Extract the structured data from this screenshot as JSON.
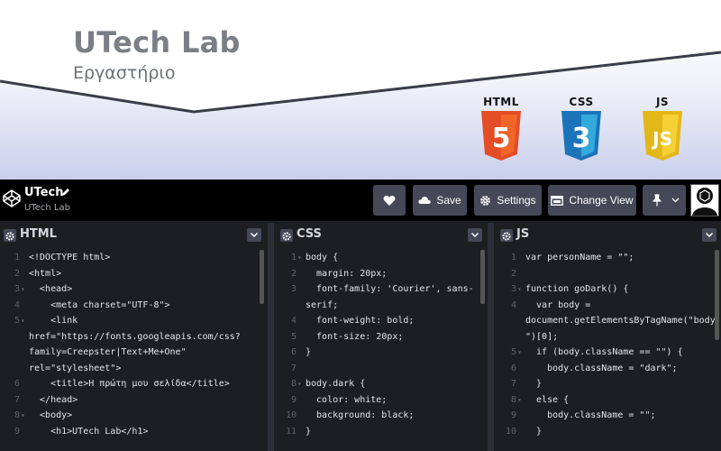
{
  "banner": {
    "title": "UTech Lab",
    "subtitle": "Εργαστήριο",
    "badges": [
      {
        "label": "HTML",
        "glyph": "5",
        "color": "#e44d26",
        "icon": "html5-icon"
      },
      {
        "label": "CSS",
        "glyph": "3",
        "color": "#1f77c7",
        "icon": "css3-icon"
      },
      {
        "label": "JS",
        "glyph": "JS",
        "color": "#f0c419",
        "icon": "js-icon"
      }
    ]
  },
  "topbar": {
    "project_title": "UTech",
    "project_author": "UTech Lab",
    "save_label": "Save",
    "settings_label": "Settings",
    "change_view_label": "Change View"
  },
  "panes": {
    "html": {
      "name": "HTML",
      "lines": [
        {
          "n": "1",
          "t": "<!DOCTYPE html>"
        },
        {
          "n": "2",
          "t": "<html>"
        },
        {
          "n": "3",
          "t": "  <head>",
          "fold": true
        },
        {
          "n": "4",
          "t": "    <meta charset=\"UTF-8\">"
        },
        {
          "n": "5",
          "t": "    <link",
          "fold": true
        },
        {
          "n": "",
          "t": "href=\"https://fonts.googleapis.com/css?"
        },
        {
          "n": "",
          "t": "family=Creepster|Text+Me+One\""
        },
        {
          "n": "",
          "t": "rel=\"stylesheet\">"
        },
        {
          "n": "6",
          "t": "    <title>Η πρώτη μου σελίδα</title>"
        },
        {
          "n": "7",
          "t": "  </head>"
        },
        {
          "n": "8",
          "t": "  <body>",
          "fold": true
        },
        {
          "n": "9",
          "t": "    <h1>UTech Lab</h1>"
        }
      ]
    },
    "css": {
      "name": "CSS",
      "lines": [
        {
          "n": "1",
          "t": "body {",
          "fold": true
        },
        {
          "n": "2",
          "t": "  margin: 20px;"
        },
        {
          "n": "3",
          "t": "  font-family: 'Courier', sans-"
        },
        {
          "n": "",
          "t": "serif;"
        },
        {
          "n": "4",
          "t": "  font-weight: bold;"
        },
        {
          "n": "5",
          "t": "  font-size: 20px;"
        },
        {
          "n": "6",
          "t": "}"
        },
        {
          "n": "7",
          "t": ""
        },
        {
          "n": "8",
          "t": "body.dark {",
          "fold": true
        },
        {
          "n": "9",
          "t": "  color: white;"
        },
        {
          "n": "10",
          "t": "  background: black;"
        },
        {
          "n": "11",
          "t": "}"
        }
      ]
    },
    "js": {
      "name": "JS",
      "lines": [
        {
          "n": "1",
          "t": "var personName = \"\";"
        },
        {
          "n": "2",
          "t": ""
        },
        {
          "n": "3",
          "t": "function goDark() {",
          "fold": true
        },
        {
          "n": "4",
          "t": "  var body ="
        },
        {
          "n": "",
          "t": "document.getElementsByTagName(\"body"
        },
        {
          "n": "",
          "t": "\")[0];"
        },
        {
          "n": "5",
          "t": "  if (body.className == \"\") {",
          "fold": true
        },
        {
          "n": "6",
          "t": "    body.className = \"dark\";"
        },
        {
          "n": "7",
          "t": "  }"
        },
        {
          "n": "8",
          "t": "  else {",
          "fold": true
        },
        {
          "n": "9",
          "t": "    body.className = \"\";"
        },
        {
          "n": "10",
          "t": "  }"
        }
      ]
    }
  }
}
